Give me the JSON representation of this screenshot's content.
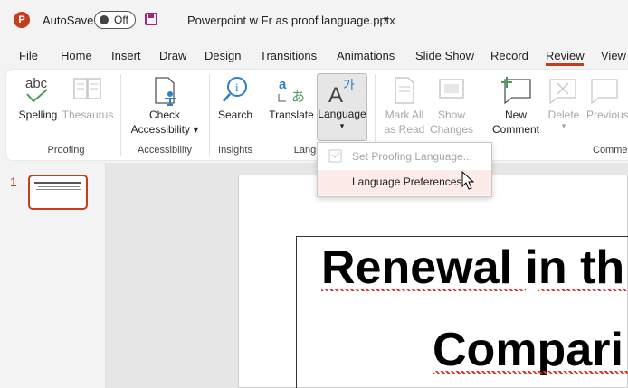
{
  "titlebar": {
    "logo": "P",
    "autosave_label": "AutoSave",
    "toggle_state": "Off",
    "document_title": "Powerpoint w Fr as proof language.pptx",
    "caret": "▾"
  },
  "tabs": [
    "File",
    "Home",
    "Insert",
    "Draw",
    "Design",
    "Transitions",
    "Animations",
    "Slide Show",
    "Record",
    "Review",
    "View"
  ],
  "active_tab": "Review",
  "ribbon": {
    "spelling": "Spelling",
    "thesaurus": "Thesaurus",
    "check_accessibility_1": "Check",
    "check_accessibility_2": "Accessibility",
    "search": "Search",
    "translate": "Translate",
    "language": "Language",
    "mark_all_1": "Mark All",
    "mark_all_2": "as Read",
    "show_changes_1": "Show",
    "show_changes_2": "Changes",
    "new_comment_1": "New",
    "new_comment_2": "Comment",
    "delete": "Delete",
    "previous": "Previous",
    "groups": {
      "proofing": "Proofing",
      "accessibility": "Accessibility",
      "insights": "Insights",
      "language": "Lang",
      "comments": "Comme"
    }
  },
  "dropdown": {
    "set_proofing": "Set Proofing Language...",
    "language_preferences": "Language Preferences..."
  },
  "slides": {
    "slide_number": "1"
  },
  "slide": {
    "line1": "Renewal in th",
    "line2": "Compari"
  },
  "colors": {
    "accent": "#c43e1c",
    "hover": "#fcebe7"
  }
}
